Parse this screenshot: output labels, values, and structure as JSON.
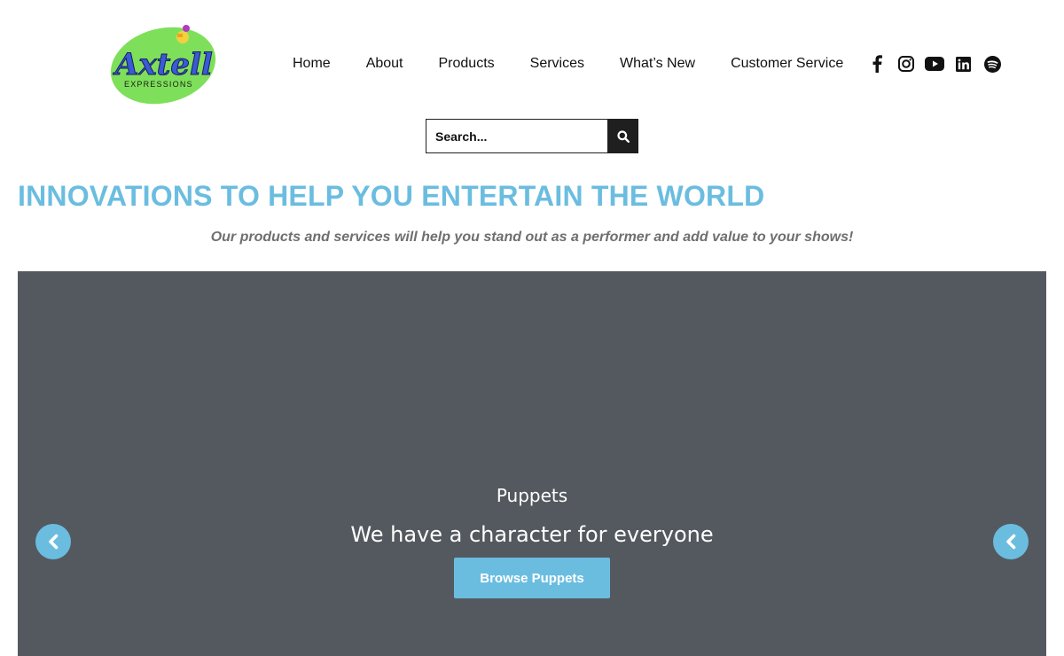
{
  "brand": {
    "logo_word": "Axtell",
    "logo_sub": "EXPRESSIONS",
    "colors": {
      "accent": "#6bbde0",
      "logo_green": "#7ee05a",
      "logo_blue": "#3a5bd6",
      "slider_bg": "#54595f"
    }
  },
  "nav": {
    "items": [
      {
        "label": "Home"
      },
      {
        "label": "About"
      },
      {
        "label": "Products"
      },
      {
        "label": "Services"
      },
      {
        "label": "What’s New"
      },
      {
        "label": "Customer Service"
      }
    ]
  },
  "social": {
    "icons": [
      "facebook-icon",
      "instagram-icon",
      "youtube-icon",
      "linkedin-icon",
      "spotify-icon"
    ]
  },
  "search": {
    "placeholder": "Search...",
    "button_icon": "search-icon"
  },
  "hero": {
    "headline": "INNOVATIONS TO HELP YOU ENTERTAIN THE WORLD",
    "subline": "Our products and services will help you stand out as a performer and add value to your shows!"
  },
  "slider": {
    "title": "Puppets",
    "description": "We have a character for everyone",
    "button_label": "Browse Puppets",
    "prev_icon": "chevron-left-icon",
    "next_icon": "chevron-left-icon"
  }
}
